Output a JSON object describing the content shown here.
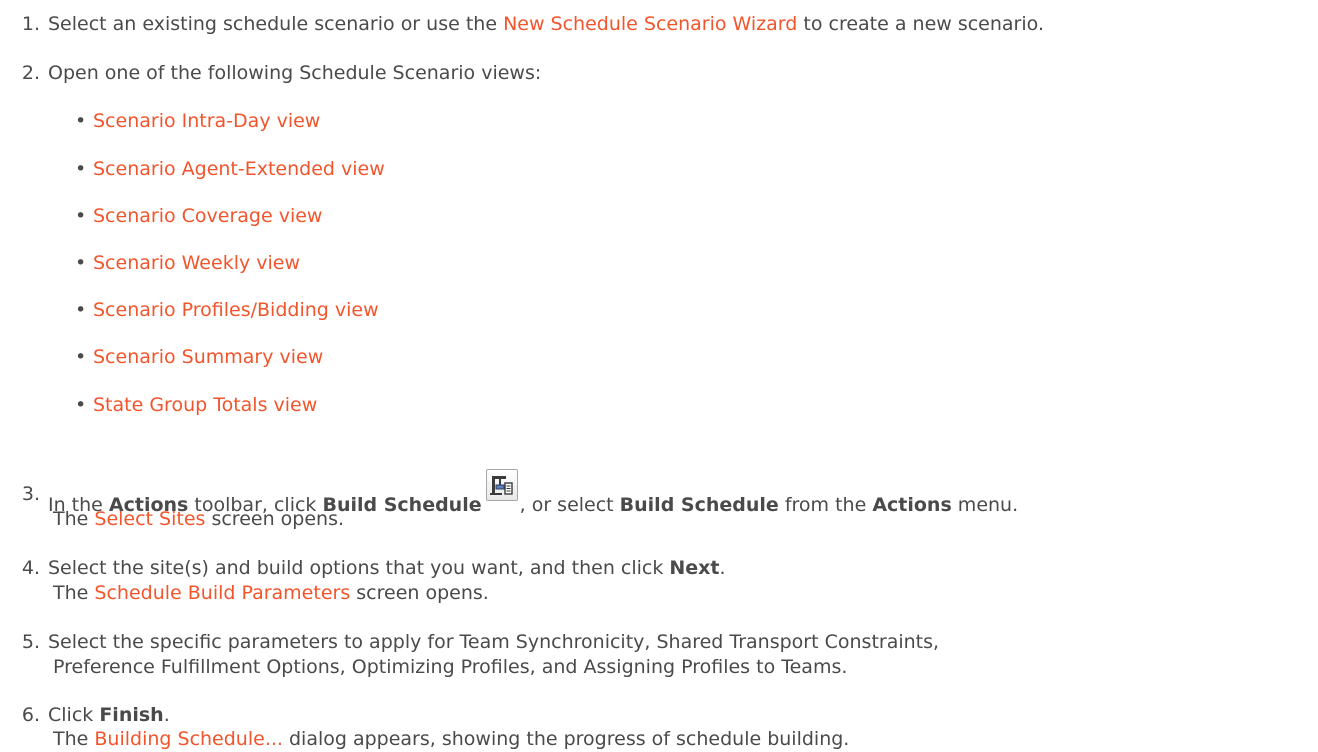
{
  "steps": [
    {
      "num": "1.",
      "pre": "Select an existing schedule scenario or use the ",
      "link": "New Schedule Scenario Wizard",
      "post": " to create a new scenario."
    },
    {
      "num": "2.",
      "text": "Open one of the following Schedule Scenario views:"
    },
    {
      "num": "3.",
      "t1": "In the ",
      "b1": "Actions",
      "t2": " toolbar, click ",
      "b2": "Build Schedule",
      "t3": ", or select ",
      "b3": "Build Schedule",
      "t4": " from the ",
      "b4": "Actions",
      "t5": " menu.",
      "sub_pre": "The ",
      "sub_link": "Select Sites",
      "sub_post": " screen opens."
    },
    {
      "num": "4.",
      "t1": "Select the site(s) and build options that you want, and then click ",
      "b1": "Next",
      "t2": ".",
      "sub_pre": "The ",
      "sub_link": "Schedule Build Parameters",
      "sub_post": " screen opens."
    },
    {
      "num": "5.",
      "text": "Select the specific parameters to apply for Team Synchronicity, Shared Transport Constraints,",
      "text2": "Preference Fulfillment Options, Optimizing Profiles, and Assigning Profiles to Teams."
    },
    {
      "num": "6.",
      "t1": "Click ",
      "b1": "Finish",
      "t2": ".",
      "sub_pre": "The ",
      "sub_link": "Building Schedule...",
      "sub_post": " dialog appears, showing the progress of schedule building."
    }
  ],
  "views": [
    "Scenario Intra-Day view",
    "Scenario Agent-Extended view",
    "Scenario Coverage view",
    "Scenario Weekly view",
    "Scenario Profiles/Bidding view",
    "Scenario Summary view",
    "State Group Totals view"
  ],
  "bullet_char": "•",
  "icons": {
    "build_schedule": "build-schedule-icon"
  },
  "colors": {
    "link": "#f2552c",
    "text": "#4a4a4a"
  }
}
